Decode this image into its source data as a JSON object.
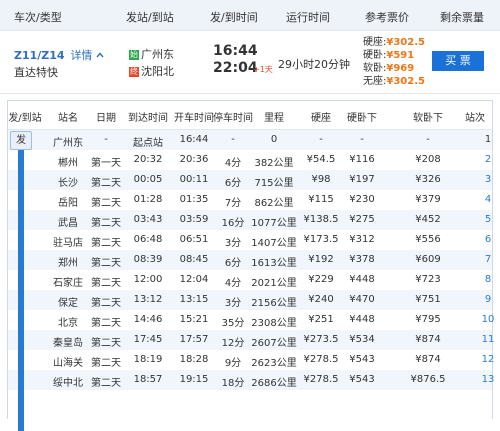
{
  "header": {
    "cols": [
      "车次/类型",
      "发站/到站",
      "发/到时间",
      "运行时间",
      "参考票价",
      "剩余票量"
    ]
  },
  "train": {
    "number": "Z11/Z14",
    "detail_label": "详情",
    "toggle_icon": "chevron-up-icon",
    "type": "直达特快",
    "from_badge": "始",
    "from_station": "广州东",
    "to_badge": "终",
    "to_station": "沈阳北",
    "depart_time": "16:44",
    "arrive_time": "22:04",
    "plus_days": "+1天",
    "duration": "29小时20分钟",
    "prices": [
      {
        "label": "硬座:",
        "value": "¥302.5"
      },
      {
        "label": "硬卧:",
        "value": "¥591"
      },
      {
        "label": "软卧:",
        "value": "¥969"
      },
      {
        "label": "无座:",
        "value": "¥302.5"
      }
    ],
    "buy_label": "买 票",
    "accent_color": "#1a72d8",
    "price_color": "#f0761a"
  },
  "schedule": {
    "columns": [
      "发/到站",
      "站名",
      "日期",
      "到达时间",
      "开车时间",
      "停车时间",
      "里程",
      "硬座",
      "硬卧下",
      "软卧下",
      "站次"
    ],
    "origin_marker": "发",
    "rows": [
      {
        "station": "广州东",
        "day": "-",
        "arrive": "起点站",
        "depart": "16:44",
        "stop": "-",
        "mileage": "0",
        "hard_seat": "-",
        "hard_sleeper": "-",
        "soft_sleeper": "-",
        "index": "1"
      },
      {
        "station": "郴州",
        "day": "第一天",
        "arrive": "20:32",
        "depart": "20:36",
        "stop": "4分",
        "mileage": "382公里",
        "hard_seat": "¥54.5",
        "hard_sleeper": "¥116",
        "soft_sleeper": "¥208",
        "index": "2"
      },
      {
        "station": "长沙",
        "day": "第二天",
        "arrive": "00:05",
        "depart": "00:11",
        "stop": "6分",
        "mileage": "715公里",
        "hard_seat": "¥98",
        "hard_sleeper": "¥197",
        "soft_sleeper": "¥326",
        "index": "3"
      },
      {
        "station": "岳阳",
        "day": "第二天",
        "arrive": "01:28",
        "depart": "01:35",
        "stop": "7分",
        "mileage": "862公里",
        "hard_seat": "¥115",
        "hard_sleeper": "¥230",
        "soft_sleeper": "¥379",
        "index": "4"
      },
      {
        "station": "武昌",
        "day": "第二天",
        "arrive": "03:43",
        "depart": "03:59",
        "stop": "16分",
        "mileage": "1077公里",
        "hard_seat": "¥138.5",
        "hard_sleeper": "¥275",
        "soft_sleeper": "¥452",
        "index": "5"
      },
      {
        "station": "驻马店",
        "day": "第二天",
        "arrive": "06:48",
        "depart": "06:51",
        "stop": "3分",
        "mileage": "1407公里",
        "hard_seat": "¥173.5",
        "hard_sleeper": "¥312",
        "soft_sleeper": "¥556",
        "index": "6"
      },
      {
        "station": "郑州",
        "day": "第二天",
        "arrive": "08:39",
        "depart": "08:45",
        "stop": "6分",
        "mileage": "1613公里",
        "hard_seat": "¥192",
        "hard_sleeper": "¥378",
        "soft_sleeper": "¥609",
        "index": "7"
      },
      {
        "station": "石家庄",
        "day": "第二天",
        "arrive": "12:00",
        "depart": "12:04",
        "stop": "4分",
        "mileage": "2021公里",
        "hard_seat": "¥229",
        "hard_sleeper": "¥448",
        "soft_sleeper": "¥723",
        "index": "8"
      },
      {
        "station": "保定",
        "day": "第二天",
        "arrive": "13:12",
        "depart": "13:15",
        "stop": "3分",
        "mileage": "2156公里",
        "hard_seat": "¥240",
        "hard_sleeper": "¥470",
        "soft_sleeper": "¥751",
        "index": "9"
      },
      {
        "station": "北京",
        "day": "第二天",
        "arrive": "14:46",
        "depart": "15:21",
        "stop": "35分",
        "mileage": "2308公里",
        "hard_seat": "¥251",
        "hard_sleeper": "¥448",
        "soft_sleeper": "¥795",
        "index": "10"
      },
      {
        "station": "秦皇岛",
        "day": "第二天",
        "arrive": "17:45",
        "depart": "17:57",
        "stop": "12分",
        "mileage": "2607公里",
        "hard_seat": "¥273.5",
        "hard_sleeper": "¥534",
        "soft_sleeper": "¥874",
        "index": "11"
      },
      {
        "station": "山海关",
        "day": "第二天",
        "arrive": "18:19",
        "depart": "18:28",
        "stop": "9分",
        "mileage": "2623公里",
        "hard_seat": "¥278.5",
        "hard_sleeper": "¥543",
        "soft_sleeper": "¥874",
        "index": "12"
      },
      {
        "station": "绥中北",
        "day": "第二天",
        "arrive": "18:57",
        "depart": "19:15",
        "stop": "18分",
        "mileage": "2686公里",
        "hard_seat": "¥278.5",
        "hard_sleeper": "¥543",
        "soft_sleeper": "¥876.5",
        "index": "13"
      }
    ]
  }
}
